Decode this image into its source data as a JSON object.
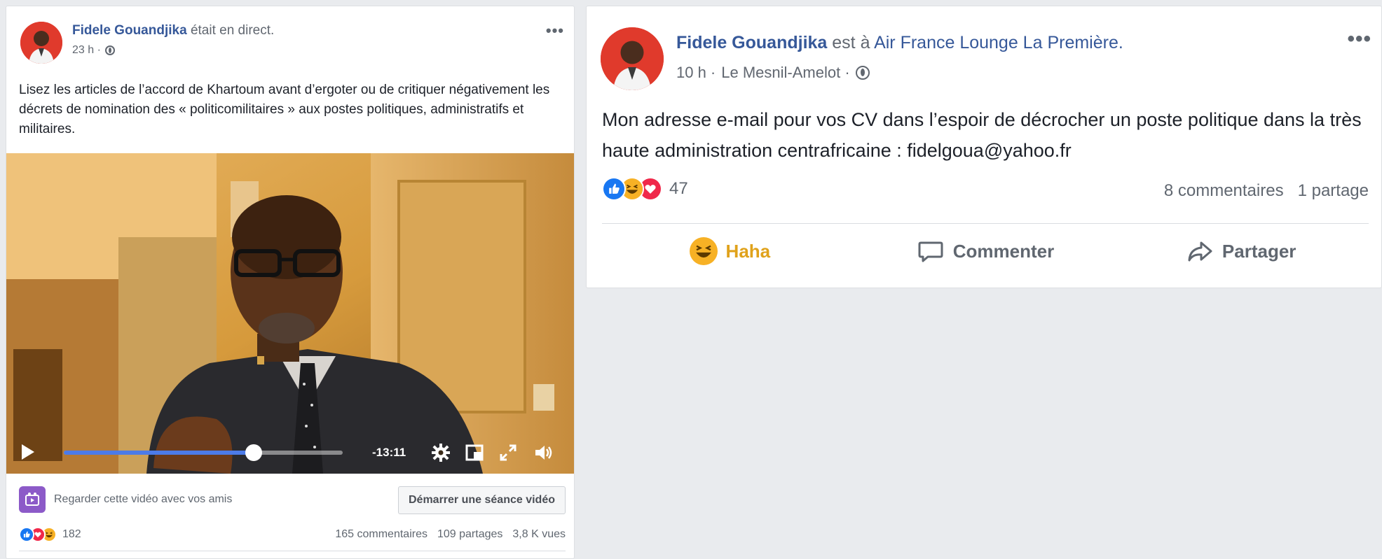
{
  "left_post": {
    "author": "Fidele Gouandjika",
    "action": "était en direct.",
    "time": "23 h ·",
    "text": "Lisez les articles de l’accord de Khartoum avant d’ergoter ou de critiquer négativement les décrets de nomination des « politicomilitaires » aux postes politiques, administratifs et militaires.",
    "video": {
      "time_remaining": "-13:11",
      "progress": 0.68
    },
    "watch_party": {
      "label": "Regarder cette vidéo avec vos amis",
      "button": "Démarrer une séance vidéo"
    },
    "reactions_count": "182",
    "comments": "165 commentaires",
    "shares": "109 partages",
    "views": "3,8 K vues"
  },
  "right_post": {
    "author": "Fidele Gouandjika",
    "action": "est à",
    "place": "Air France Lounge La Première.",
    "time": "10 h ·",
    "location": "Le Mesnil-Amelot ·",
    "text": "Mon adresse e-mail pour vos CV dans l’espoir de décrocher un poste politique dans la très haute administration centrafricaine : fidelgoua@yahoo.fr",
    "reactions_count": "47",
    "comments": "8 commentaires",
    "shares": "1 partage",
    "actions": {
      "reaction": "Haha",
      "comment": "Commenter",
      "share": "Partager"
    }
  },
  "colors": {
    "author_link": "#365899",
    "like_blue": "#1877f2",
    "love_red": "#f0284a",
    "haha_yellow": "#f7b125",
    "video_progress": "#4c7be8"
  }
}
